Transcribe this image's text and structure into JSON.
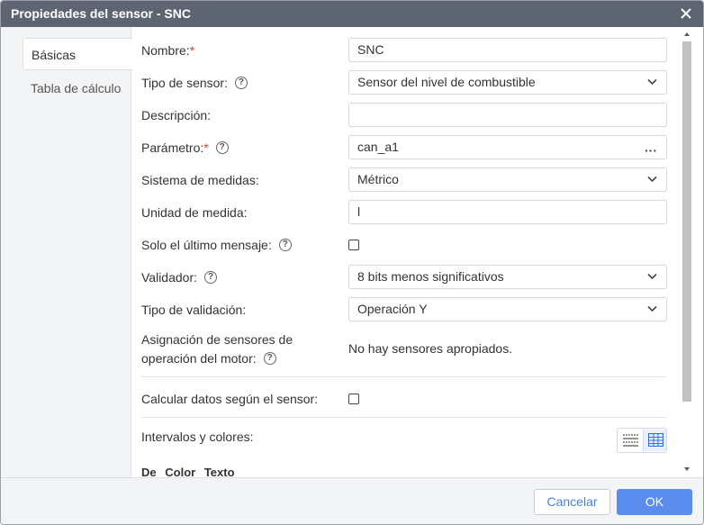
{
  "window": {
    "title": "Propiedades del sensor - SNC"
  },
  "tabs": [
    {
      "label": "Básicas"
    },
    {
      "label": "Tabla de cálculo"
    }
  ],
  "form": {
    "name": {
      "label": "Nombre:",
      "required": "*",
      "value": "SNC"
    },
    "sensor_type": {
      "label": "Tipo de sensor:",
      "value": "Sensor del nivel de combustible"
    },
    "description": {
      "label": "Descripción:",
      "value": ""
    },
    "parameter": {
      "label": "Parámetro:",
      "required": "*",
      "value": "can_a1",
      "more": "···"
    },
    "measure_system": {
      "label": "Sistema de medidas:",
      "value": "Métrico"
    },
    "unit": {
      "label": "Unidad de medida:",
      "value": "l"
    },
    "last_message_only": {
      "label": "Solo el último mensaje:",
      "checked": false
    },
    "validator": {
      "label": "Validador:",
      "value": "8 bits menos significativos"
    },
    "validation_type": {
      "label": "Tipo de validación:",
      "value": "Operación Y"
    },
    "engine_sensors": {
      "label_line1": "Asignación de sensores de",
      "label_line2": "operación del motor:",
      "value": "No hay sensores apropiados."
    },
    "calc_by_sensor": {
      "label": "Calcular datos según el sensor:",
      "checked": false
    },
    "intervals": {
      "label": "Intervalos y colores:"
    },
    "columns": [
      "De",
      "Color",
      "Texto"
    ]
  },
  "help_glyph": "?",
  "footer": {
    "cancel_label": "Cancelar",
    "ok_label": "OK"
  },
  "colors": {
    "titlebar": "#5d6573",
    "accent": "#5b8def",
    "required": "#e53935"
  }
}
